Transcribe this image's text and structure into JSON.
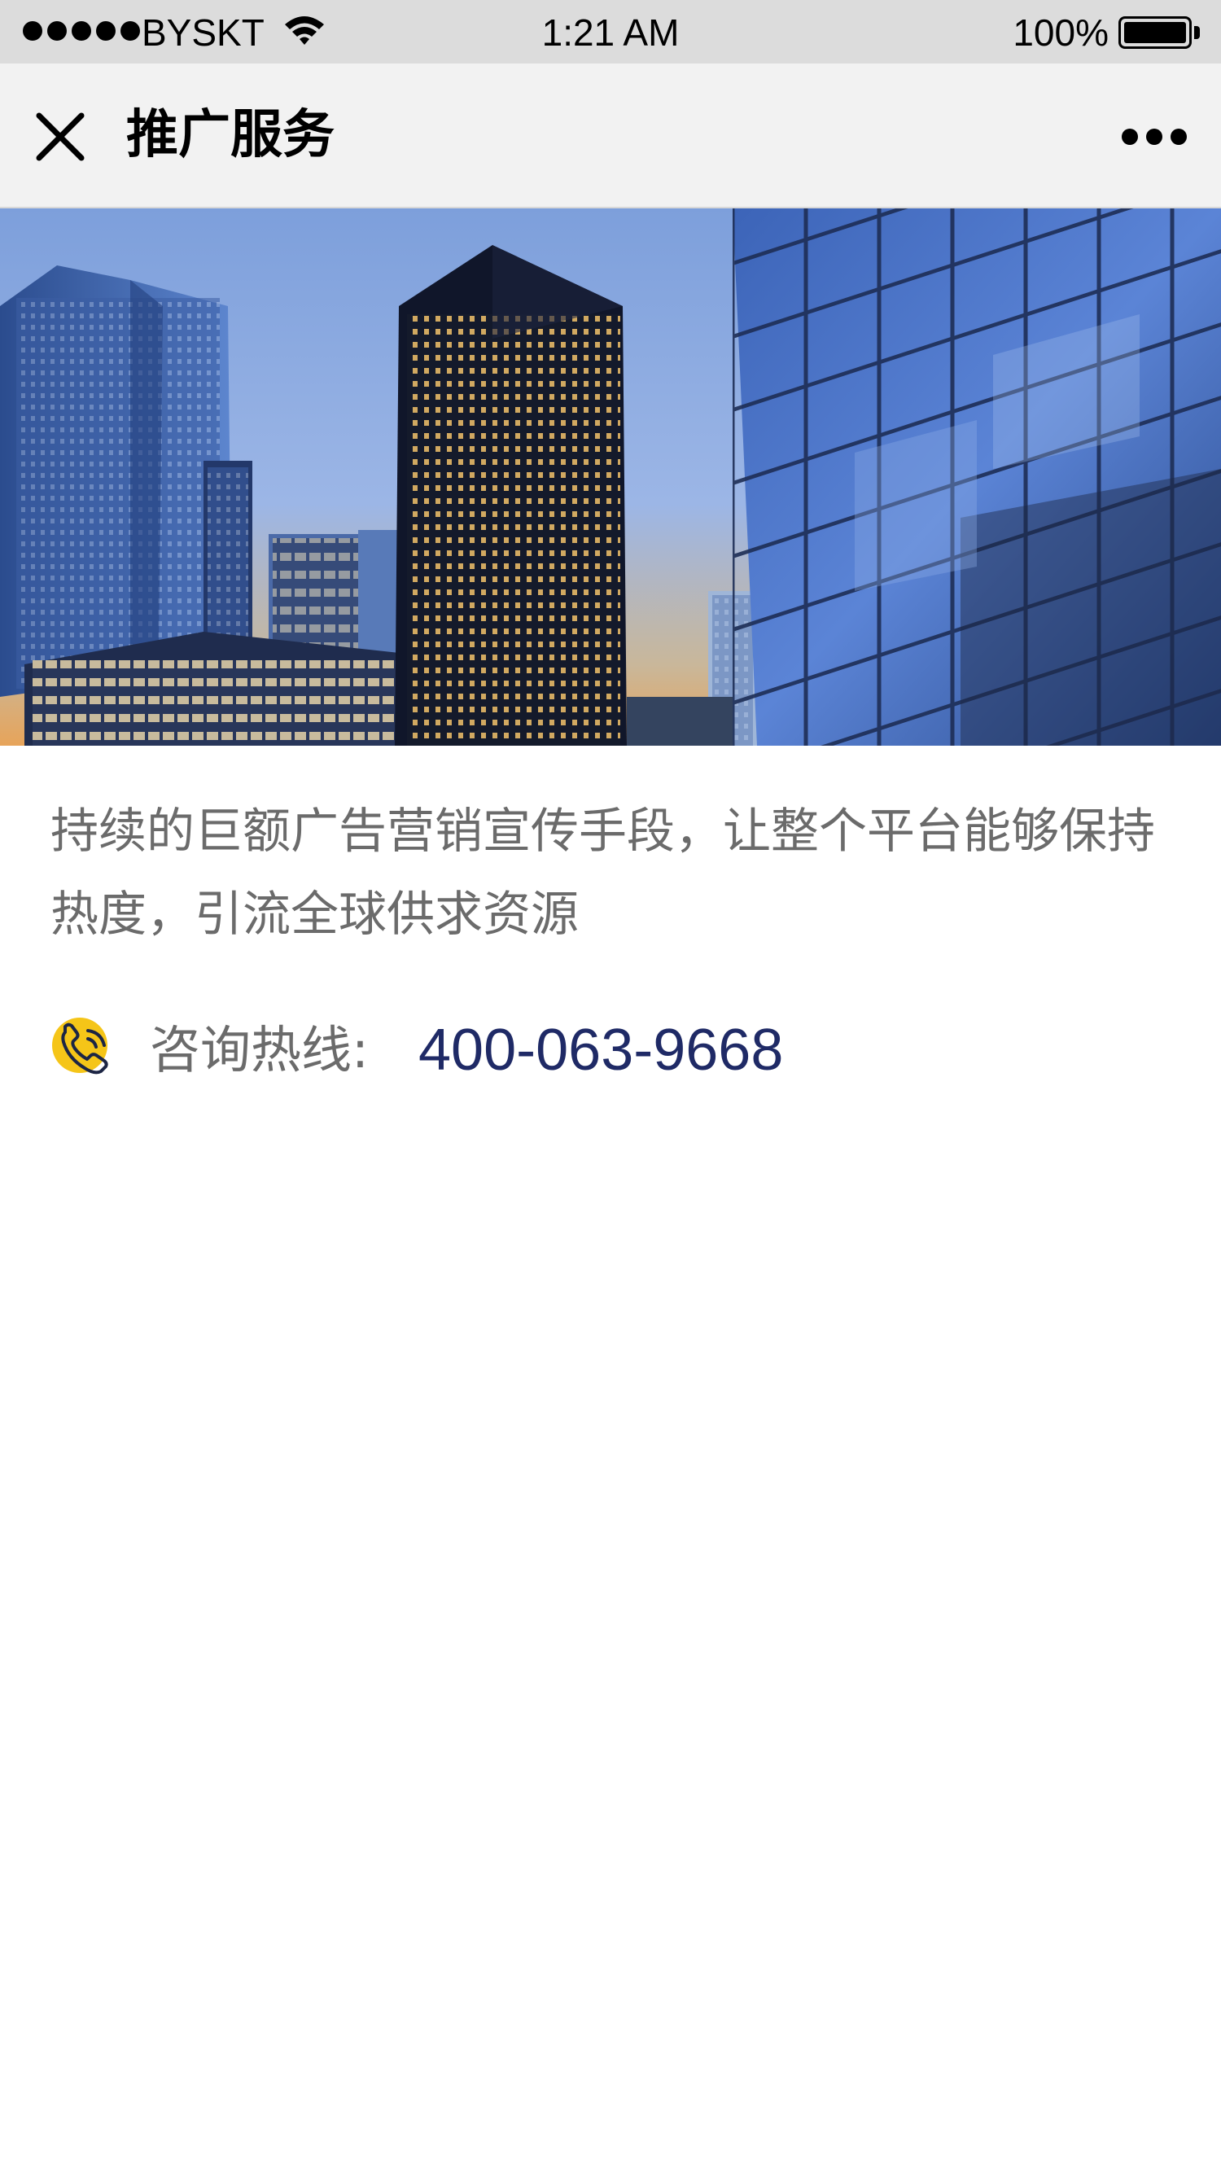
{
  "status_bar": {
    "carrier": "BYSKT",
    "time": "1:21 AM",
    "battery_percent": "100%",
    "battery_level": 1.0,
    "icons": [
      "signal-dots-icon",
      "wifi-icon",
      "battery-icon"
    ]
  },
  "nav": {
    "title": "推广服务",
    "close_icon": "close-icon",
    "more_icon": "more-icon"
  },
  "hero": {
    "image": "city-skyline-photo"
  },
  "content": {
    "description": "持续的巨额广告营销宣传手段，让整个平台能够保持热度，引流全球供求资源",
    "hotline_label": "咨询热线:",
    "hotline_number": "400-063-9668",
    "phone_icon": "phone-icon"
  },
  "colors": {
    "status_bar_bg": "#dcdcdc",
    "nav_bg": "#f2f2f2",
    "body_text": "#6b6b6b",
    "hotline_number": "#1f2a66",
    "phone_icon_bg": "#f5c518"
  }
}
